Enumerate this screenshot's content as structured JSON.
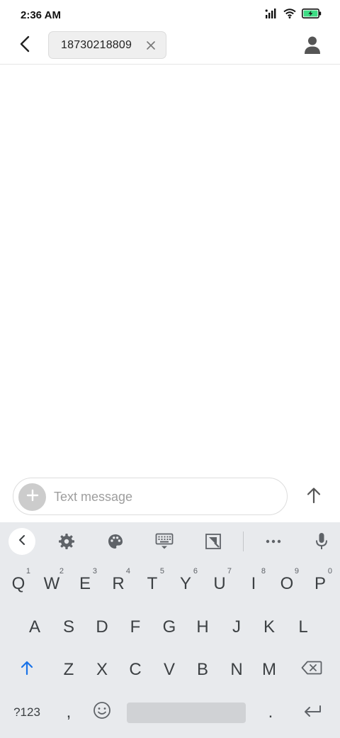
{
  "status_bar": {
    "time": "2:36 AM",
    "icons": [
      "signal-icon",
      "wifi-icon",
      "battery-charging-icon"
    ],
    "battery_color": "#3ddc84"
  },
  "header": {
    "back_icon": "back-arrow-icon",
    "recipient": "18730218809",
    "recipient_close_icon": "close-icon",
    "contact_icon": "person-icon"
  },
  "compose": {
    "placeholder": "Text message",
    "value": "",
    "attach_icon": "plus-icon",
    "send_icon": "arrow-up-icon"
  },
  "keyboard": {
    "toolbar": [
      "collapse-icon",
      "settings-icon",
      "palette-icon",
      "keyboard-layout-icon",
      "one-handed-icon",
      "more-icon",
      "microphone-icon"
    ],
    "accent_color": "#1a73e8",
    "row1": [
      {
        "label": "Q",
        "hint": "1"
      },
      {
        "label": "W",
        "hint": "2"
      },
      {
        "label": "E",
        "hint": "3"
      },
      {
        "label": "R",
        "hint": "4"
      },
      {
        "label": "T",
        "hint": "5"
      },
      {
        "label": "Y",
        "hint": "6"
      },
      {
        "label": "U",
        "hint": "7"
      },
      {
        "label": "I",
        "hint": "8"
      },
      {
        "label": "O",
        "hint": "9"
      },
      {
        "label": "P",
        "hint": "0"
      }
    ],
    "row2": [
      "A",
      "S",
      "D",
      "F",
      "G",
      "H",
      "J",
      "K",
      "L"
    ],
    "row3": [
      "Z",
      "X",
      "C",
      "V",
      "B",
      "N",
      "M"
    ],
    "row4": {
      "symbols": "?123",
      "comma": ",",
      "period": "."
    }
  }
}
